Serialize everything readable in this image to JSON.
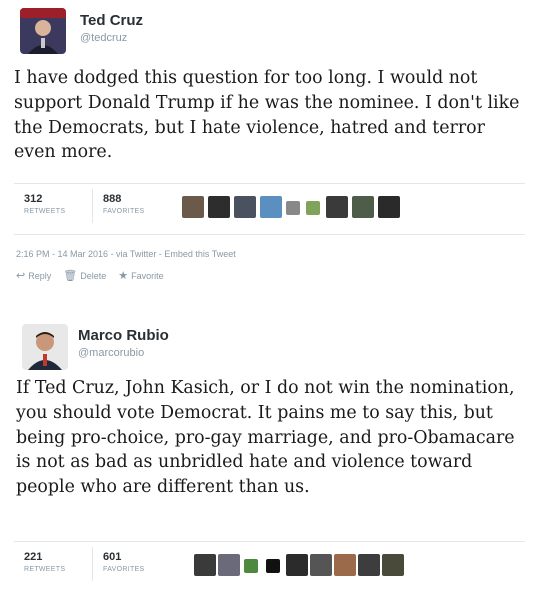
{
  "tweets": [
    {
      "name": "Ted Cruz",
      "handle": "@tedcruz",
      "text": "I have dodged this question for too long. I would not support Donald Trump if he was the nominee. I don't like the Democrats, but I hate violence, hatred and terror even more.",
      "retweets": "312",
      "retweets_label": "RETWEETS",
      "favorites": "888",
      "favorites_label": "FAVORITES",
      "timestamp": "2:16 PM - 14 Mar 2016 - via Twitter - Embed this Tweet",
      "actions": {
        "reply": "Reply",
        "delete": "Delete",
        "favorite": "Favorite"
      }
    },
    {
      "name": "Marco Rubio",
      "handle": "@marcorubio",
      "text": "If Ted Cruz, John Kasich, or I do not win the nomination, you should vote Democrat. It pains me to say this, but being pro-choice, pro-gay marriage, and pro-Obamacare is not as bad as unbridled hate and violence toward people who are different than us.",
      "retweets": "221",
      "retweets_label": "RETWEETS",
      "favorites": "601",
      "favorites_label": "FAVORITES"
    }
  ],
  "colors": {
    "text_primary": "#292f33",
    "text_muted": "#8899a6",
    "border": "#e1e8ed"
  }
}
